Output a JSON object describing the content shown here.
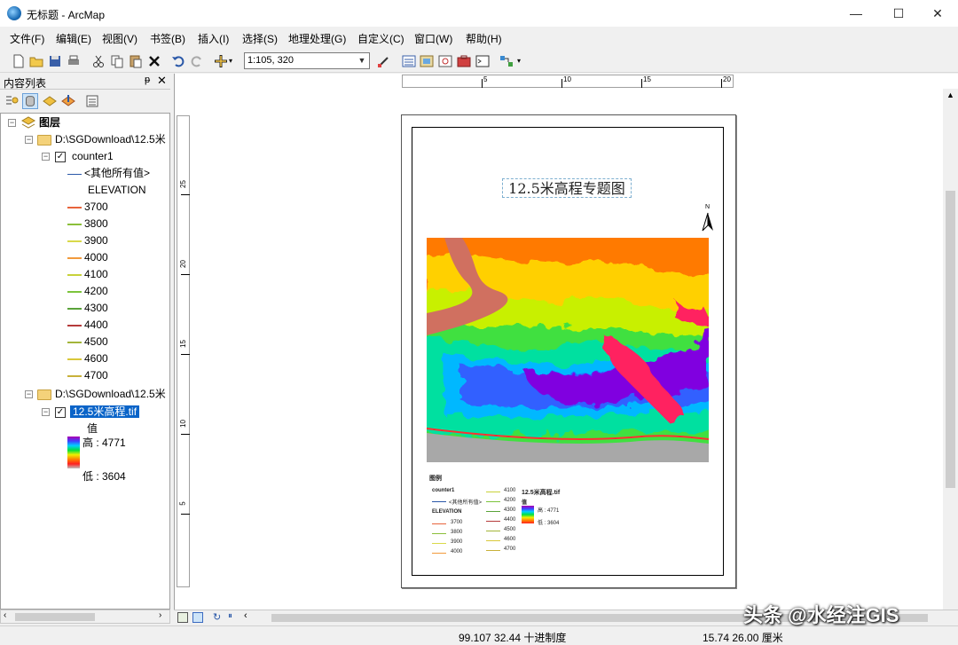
{
  "window": {
    "title": "无标题 - ArcMap",
    "minimize": "—",
    "maximize": "☐",
    "close": "✕"
  },
  "menu": [
    "文件(F)",
    "编辑(E)",
    "视图(V)",
    "书签(B)",
    "插入(I)",
    "选择(S)",
    "地理处理(G)",
    "自定义(C)",
    "窗口(W)",
    "帮助(H)"
  ],
  "toolbar": {
    "scale": "1:105, 320"
  },
  "toc": {
    "header": "内容列表",
    "pin": "ᵽ",
    "close": "✕",
    "root": "图层",
    "group1": "D:\\SGDownload\\12.5米",
    "layer1": "counter1",
    "other_values": "<其他所有值>",
    "field": "ELEVATION",
    "classes": [
      {
        "label": "3700",
        "color": "#e8643c"
      },
      {
        "label": "3800",
        "color": "#8bbf3a"
      },
      {
        "label": "3900",
        "color": "#d9d94a"
      },
      {
        "label": "4000",
        "color": "#f29a3c"
      },
      {
        "label": "4100",
        "color": "#c8d23a"
      },
      {
        "label": "4200",
        "color": "#7cc43c"
      },
      {
        "label": "4300",
        "color": "#5aa33a"
      },
      {
        "label": "4400",
        "color": "#b53b3b"
      },
      {
        "label": "4500",
        "color": "#a3b53a"
      },
      {
        "label": "4600",
        "color": "#d9c83a"
      },
      {
        "label": "4700",
        "color": "#c8b13a"
      }
    ],
    "group2": "D:\\SGDownload\\12.5米",
    "layer2": "12.5米高程.tif",
    "value_label": "值",
    "high": "高 : 4771",
    "low": "低 : 3604"
  },
  "layout": {
    "title": "12.5米高程专题图",
    "north": "N",
    "legend": {
      "heading": "图例",
      "layer1": "counter1",
      "other": "<其他所有值>",
      "field": "ELEVATION",
      "col1": [
        "3700",
        "3800",
        "3900",
        "4000"
      ],
      "col2": [
        "4100",
        "4200",
        "4300",
        "4400",
        "4500",
        "4600",
        "4700"
      ],
      "raster": "12.5米高程.tif",
      "value": "值",
      "high": "高 : 4771",
      "low": "低 : 3604"
    },
    "hruler": [
      "5",
      "10",
      "15",
      "20"
    ],
    "vruler": [
      "25",
      "20",
      "15",
      "10",
      "5"
    ]
  },
  "status": {
    "coords": "99.107  32.44 十进制度",
    "page": "15.74  26.00 厘米"
  },
  "watermark": "头条 @水经注GIS"
}
